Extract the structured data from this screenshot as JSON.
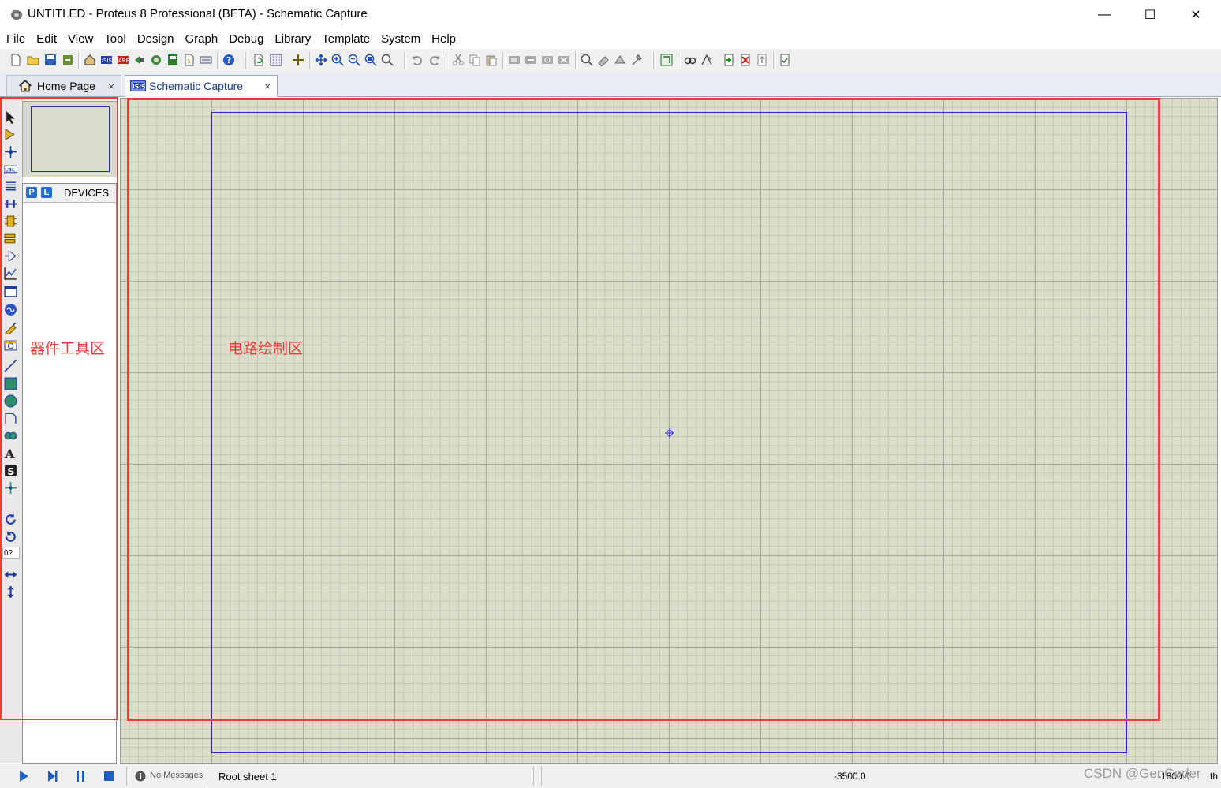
{
  "window": {
    "title": "UNTITLED - Proteus 8 Professional (BETA) - Schematic Capture",
    "minimize_glyph": "—",
    "maximize_glyph": "☐",
    "close_glyph": "✕"
  },
  "menu": {
    "items": [
      "File",
      "Edit",
      "View",
      "Tool",
      "Design",
      "Graph",
      "Debug",
      "Library",
      "Template",
      "System",
      "Help"
    ]
  },
  "tabs": [
    {
      "label": "Home Page",
      "icon": "home-icon",
      "active": false,
      "close": "×"
    },
    {
      "label": "Schematic Capture",
      "icon": "isis-icon",
      "active": true,
      "close": "×"
    }
  ],
  "device_panel": {
    "p_button": "P",
    "l_button": "L",
    "header": "DEVICES"
  },
  "toolstrip": {
    "rotation_value": "0?"
  },
  "annotations": {
    "left_label": "器件工具区",
    "right_label": "电路绘制区",
    "color": "#f13b3b"
  },
  "status": {
    "messages": "No Messages",
    "sheet": "Root sheet 1",
    "coord_x": "-3500.0",
    "coord_y": "-1800.0",
    "units": "th"
  },
  "watermark": "CSDN @GenCoder",
  "colors": {
    "canvas_bg": "#dcdcca",
    "sheet_border": "#2a2ad0",
    "accent_blue": "#1f6fd6"
  }
}
